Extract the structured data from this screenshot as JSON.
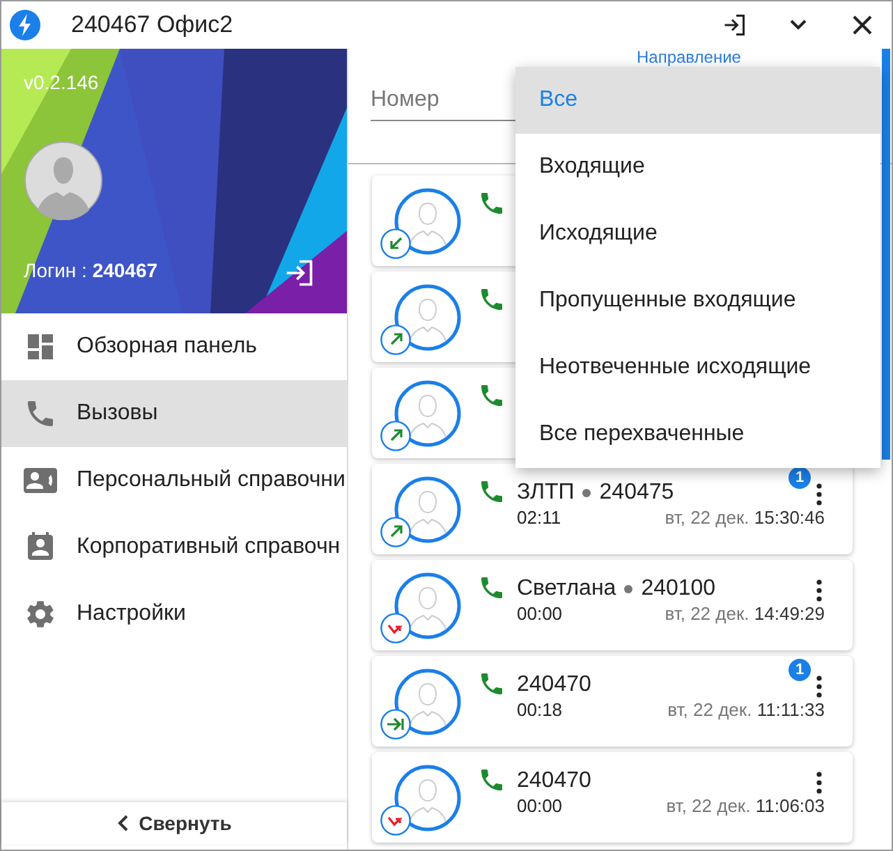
{
  "window": {
    "title": "240467 Офис2"
  },
  "profile": {
    "version": "v0.2.146",
    "login_label": "Логин :",
    "login": "240467"
  },
  "sidebar": {
    "items": [
      {
        "label": "Обзорная панель",
        "kind": "dashboard",
        "selected": false
      },
      {
        "label": "Вызовы",
        "kind": "phone",
        "selected": true
      },
      {
        "label": "Персональный справочни",
        "kind": "contacts",
        "selected": false
      },
      {
        "label": "Корпоративный справочн",
        "kind": "badge",
        "selected": false
      },
      {
        "label": "Настройки",
        "kind": "settings",
        "selected": false
      }
    ],
    "collapse": "Свернуть"
  },
  "filters": {
    "number_placeholder": "Номер",
    "direction_label": "Направление"
  },
  "direction_menu": [
    {
      "label": "Все",
      "selected": true
    },
    {
      "label": "Входящие",
      "selected": false
    },
    {
      "label": "Исходящие",
      "selected": false
    },
    {
      "label": "Пропущенные входящие",
      "selected": false
    },
    {
      "label": "Неотвеченные исходящие",
      "selected": false
    },
    {
      "label": "Все перехваченные",
      "selected": false
    }
  ],
  "calls": [
    {
      "kind": "incoming"
    },
    {
      "kind": "outgoing"
    },
    {
      "kind": "outgoing"
    },
    {
      "kind": "outgoing",
      "name": "ЗЛТП",
      "number": "240475",
      "duration": "02:11",
      "date": "вт, 22 дек.",
      "time": "15:30:46",
      "badge": "1"
    },
    {
      "kind": "missed",
      "name": "Светлана",
      "number": "240100",
      "duration": "00:00",
      "date": "вт, 22 дек.",
      "time": "14:49:29"
    },
    {
      "kind": "transferred",
      "number": "240470",
      "duration": "00:18",
      "date": "вт, 22 дек.",
      "time": "11:11:33",
      "badge": "1"
    },
    {
      "kind": "missed",
      "number": "240470",
      "duration": "00:00",
      "date": "вт, 22 дек.",
      "time": "11:06:03"
    }
  ]
}
